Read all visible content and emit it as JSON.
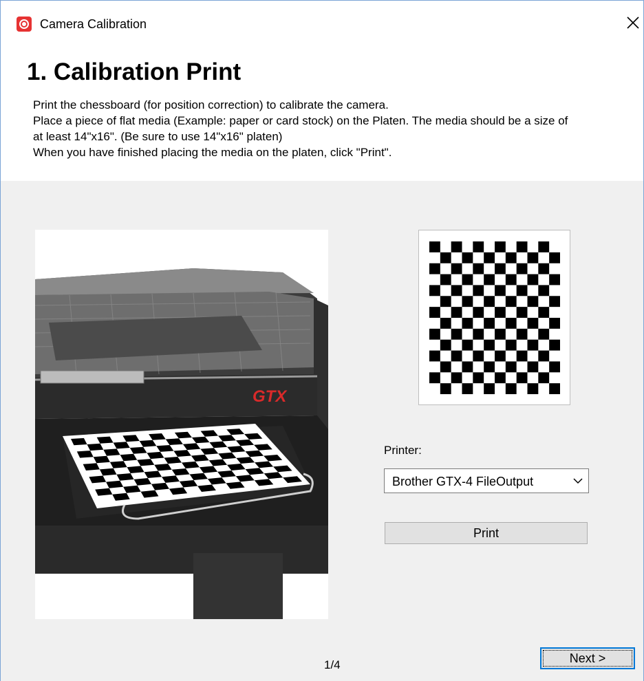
{
  "window": {
    "title": "Camera Calibration",
    "app_icon": "camera-target-icon",
    "close_icon": "close-icon"
  },
  "header": {
    "step_title": "1. Calibration Print",
    "instructions": [
      "Print the chessboard (for position correction) to calibrate the camera.",
      "Place a piece of flat media (Example: paper or card stock) on the Platen. The media should be a size of",
      "at least 14\"x16\". (Be sure to use 14\"x16\" platen)",
      "When you have finished placing the media on the platen, click \"Print\"."
    ]
  },
  "main": {
    "printer_brand_text": "GTX",
    "printer_label": "Printer:",
    "printer_select": {
      "value": "Brother GTX-4 FileOutput",
      "icon": "chevron-down-icon"
    },
    "print_button": "Print"
  },
  "footer": {
    "page_indicator": "1/4",
    "next_button": "Next >"
  },
  "colors": {
    "accent": "#0078d7",
    "app_icon": "#e63232",
    "gtx_brand": "#d92a2a",
    "panel_bg": "#f0f0f0",
    "button_bg": "#e1e1e1"
  }
}
